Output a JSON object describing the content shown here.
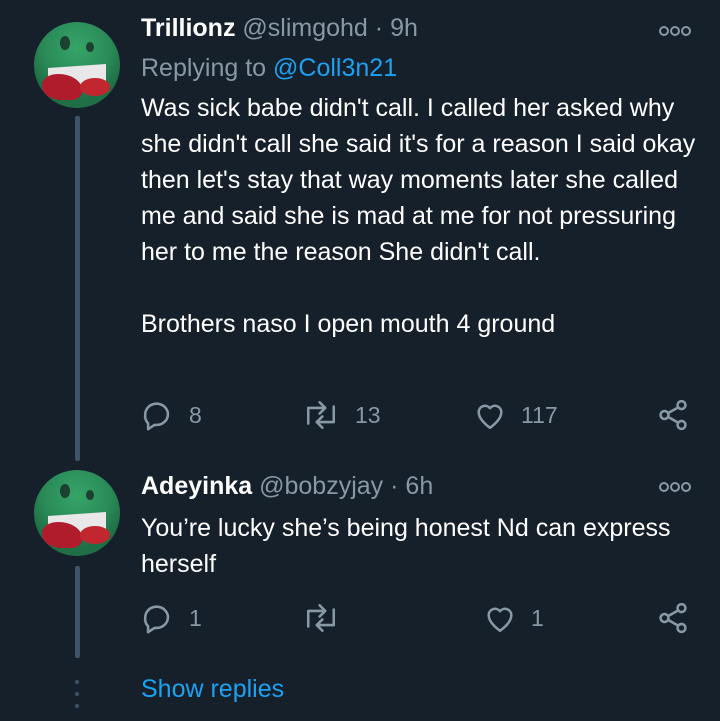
{
  "tweets": [
    {
      "name": "Trillionz",
      "handle": "@slimgohd",
      "time": "9h",
      "replying_label": "Replying to",
      "replying_to": "@Coll3n21",
      "text": "Was sick babe didn't call. I called her asked why she didn't call she said it's for a reason I said okay then let's stay that way moments later she called me and said she is mad at me for not pressuring her to me the reason She didn't call.\n\nBrothers naso I open mouth 4 ground",
      "replies": "8",
      "retweets": "13",
      "likes": "117"
    },
    {
      "name": "Adeyinka",
      "handle": "@bobzyjay",
      "time": "6h",
      "text": "You’re lucky she’s being honest Nd can express herself",
      "replies": "1",
      "retweets": "",
      "likes": "1"
    }
  ],
  "separator": "·",
  "show_replies": "Show replies",
  "icons": [
    "more-icon",
    "reply-icon",
    "retweet-icon",
    "like-icon",
    "share-icon"
  ],
  "colors": {
    "background": "#15202b",
    "muted": "#8899a6",
    "accent": "#1da1f2",
    "text": "#ffffff"
  }
}
